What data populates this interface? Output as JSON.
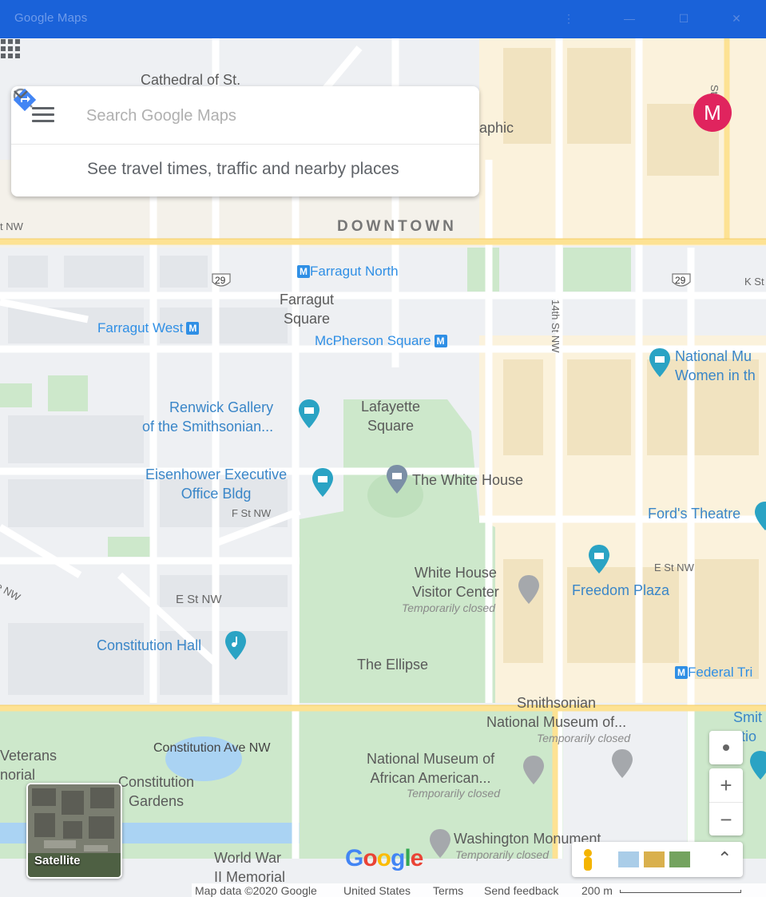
{
  "window": {
    "title": "Google Maps"
  },
  "search": {
    "placeholder": "Search Google Maps",
    "travel_text": "See travel times, traffic and nearby places"
  },
  "account": {
    "initial": "M",
    "color": "#e0245e"
  },
  "labels": {
    "cathedral": "Cathedral of St.",
    "graphic": "aphic",
    "downtown": "DOWNTOWN",
    "farragut_north": "Farragut North",
    "farragut_square": "Farragut\nSquare",
    "farragut_west": "Farragut West",
    "mcpherson": "McPherson Square",
    "fourteenth": "14th St NW",
    "national_museum_women": "National Mu\nWomen in th",
    "renwick": "Renwick Gallery\nof the Smithsonian...",
    "lafayette": "Lafayette\nSquare",
    "eisenhower": "Eisenhower Executive\nOffice Bldg",
    "white_house": "The White House",
    "f_st": "F St NW",
    "fords": "Ford's Theatre",
    "wh_visitor": "White House\nVisitor Center",
    "temp_closed": "Temporarily closed",
    "freedom": "Freedom Plaza",
    "e_st_right": "E St NW",
    "e_st": "E St NW",
    "constitution_hall": "Constitution Hall",
    "ellipse": "The Ellipse",
    "federal_tri": "Federal Tri",
    "smithsonian_nm": "Smithsonian\nNational Museum of...",
    "smith_right": "Smit\natio",
    "veterans": "Veterans\nnorial",
    "constitution_ave": "Constitution Ave NW",
    "nmaah": "National Museum of\nAfrican American...",
    "constitution_gardens": "Constitution\nGardens",
    "world_war": "World War\nII Memorial",
    "washington_monument": "Washington Monument",
    "k_st": "K St",
    "ave_nw": "e NW",
    "st_nw_left": "t NW",
    "route_29": "29",
    "metro_badge": "M",
    "st_top_right": "St"
  },
  "controls": {
    "satellite": "Satellite",
    "zoom_in": "+",
    "zoom_out": "−",
    "expand": "⌃"
  },
  "footer": {
    "map_data": "Map data ©2020 Google",
    "country": "United States",
    "terms": "Terms",
    "feedback": "Send feedback",
    "scale": "200 m"
  },
  "logo": {
    "text": "Google"
  }
}
